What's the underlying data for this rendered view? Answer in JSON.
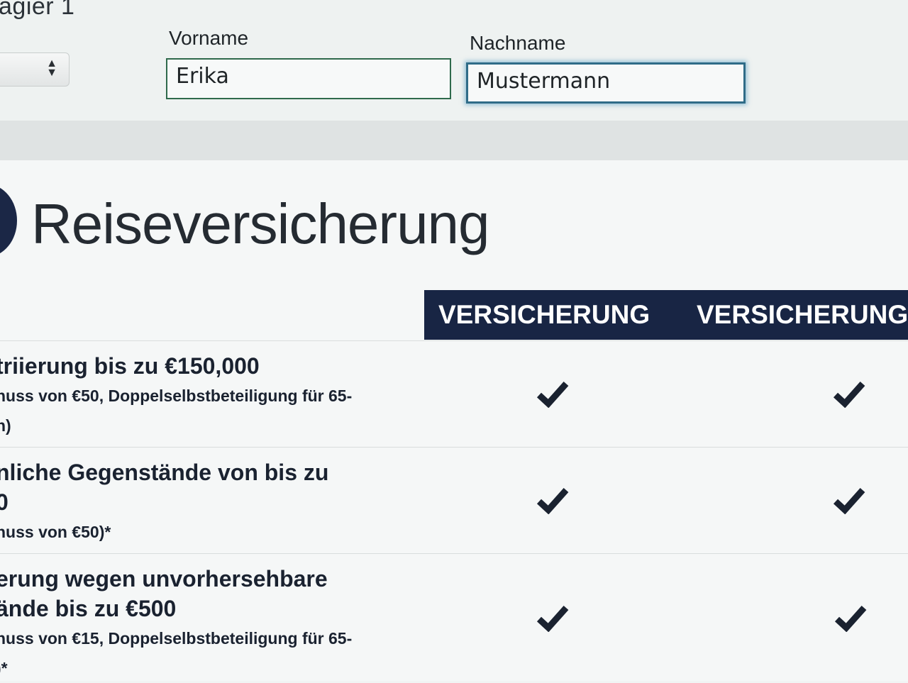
{
  "form": {
    "passenger_title": "agier 1",
    "vorname_label": "Vorname",
    "vorname_value": "Erika",
    "nachname_label": "Nachname",
    "nachname_value": "Mustermann"
  },
  "page": {
    "title": "Reiseversicherung"
  },
  "table": {
    "columns": [
      "VERSICHERUNG",
      "VERSICHERUNG"
    ],
    "rows": [
      {
        "title_lines": [
          "triierung bis zu €150,000"
        ],
        "note_lines": [
          "huss von €50, Doppelselbstbeteiligung für 65-",
          "n)"
        ],
        "col1": "✔",
        "col2": "✔"
      },
      {
        "title_lines": [
          "nliche Gegenstände von bis zu",
          "0"
        ],
        "note_lines": [
          "huss von €50)*"
        ],
        "col1": "✔",
        "col2": "✔"
      },
      {
        "title_lines": [
          "erung wegen unvorhersehbare",
          "ände bis zu €500"
        ],
        "note_lines": [
          "huss von €15, Doppelselbstbeteiligung für 65-",
          ")*"
        ],
        "col1": "✔",
        "col2": "✔"
      }
    ]
  },
  "colors": {
    "header_band": "#182544",
    "focus_ring": "#2f6c88"
  }
}
